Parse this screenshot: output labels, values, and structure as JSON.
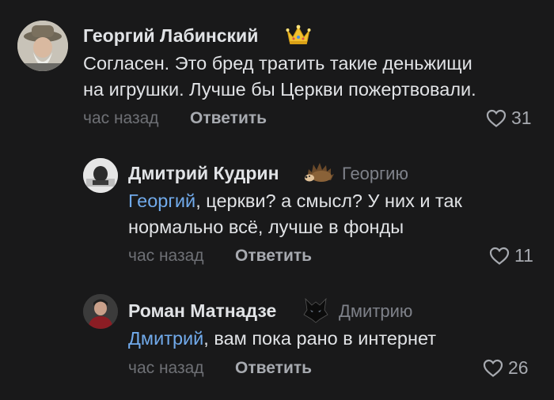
{
  "comments": [
    {
      "author": "Георгий Лабинский",
      "badge": "crown-icon",
      "text_lines": [
        "Согласен. Это бред тратить такие деньжищи",
        "на игрушки. Лучше бы Церкви пожертвовали."
      ],
      "time": "час назад",
      "reply_label": "Ответить",
      "likes": "31"
    },
    {
      "author": "Дмитрий Кудрин",
      "badge": "hedgehog-icon",
      "reply_to": "Георгию",
      "mention": "Георгий",
      "text_line1_rest": ", церкви? а смысл? У них и так",
      "text_line2": "нормально всё, лучше в фонды",
      "time": "час назад",
      "reply_label": "Ответить",
      "likes": "11"
    },
    {
      "author": "Роман Матнадзе",
      "badge": "wolf-icon",
      "reply_to": "Дмитрию",
      "mention": "Дмитрий",
      "text_line1_rest": ", вам пока рано в интернет",
      "time": "час назад",
      "reply_label": "Ответить",
      "likes": "26"
    }
  ],
  "colors": {
    "background": "#19191a",
    "text": "#e1e3e6",
    "mention": "#71aaeb",
    "secondary": "#7e8189"
  }
}
